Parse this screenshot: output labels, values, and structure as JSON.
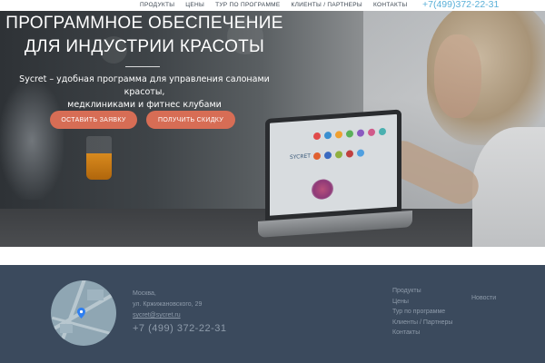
{
  "nav": {
    "items": [
      "ПРОДУКТЫ",
      "ЦЕНЫ",
      "ТУР ПО ПРОГРАММЕ",
      "КЛИЕНТЫ / ПАРТНЕРЫ",
      "КОНТАКТЫ"
    ],
    "phone": "+7(499)372-22-31"
  },
  "hero": {
    "headline_line1": "ПРОГРАММНОЕ ОБЕСПЕЧЕНИЕ",
    "headline_line2": "ДЛЯ ИНДУСТРИИ КРАСОТЫ",
    "subtitle_line1": "Sycret – удобная программа для управления салонами красоты,",
    "subtitle_line2": "медклиниками и фитнес клубами",
    "btn_request": "ОСТАВИТЬ ЗАЯВКУ",
    "btn_discount": "ПОЛУЧИТЬ СКИДКУ",
    "screen_logo": "SYCRET"
  },
  "footer": {
    "city": "Москва,",
    "street": "ул. Кржижановского, 29",
    "email": "sycret@sycret.ru",
    "phone": "+7 (499) 372-22-31",
    "links_col1": [
      "Продукты",
      "Цены",
      "Тур по программе",
      "Клиенты / Партнеры",
      "Контакты"
    ],
    "links_col2": [
      "Новости"
    ]
  },
  "colors": {
    "accent_button": "#d76d55",
    "footer_bg": "#3b4a5d",
    "phone_link": "#5ab0d8"
  }
}
